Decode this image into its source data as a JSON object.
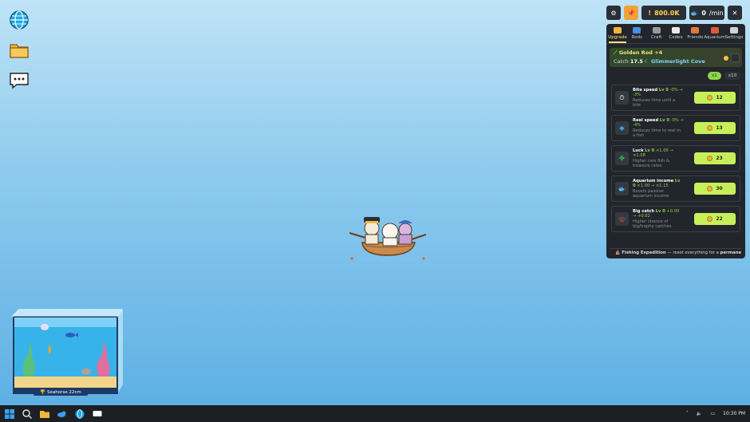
{
  "toolbar": {
    "settings_icon": "gear-icon",
    "pin_icon": "pin-icon",
    "money": "800.0K",
    "rate_value": "0",
    "rate_unit": "/min",
    "close_icon": "close-icon"
  },
  "tabs": [
    {
      "label": "Upgrade",
      "active": true
    },
    {
      "label": "Rods"
    },
    {
      "label": "Craft"
    },
    {
      "label": "Codex"
    },
    {
      "label": "Friends"
    },
    {
      "label": "Aquarium"
    },
    {
      "label": "Settings"
    }
  ],
  "rod": {
    "name": "Golden Rod +4",
    "catch_label": "Catch",
    "catch_value": "17.5",
    "location": "Glimmerlight Cove"
  },
  "multipliers": [
    "x1",
    "x10"
  ],
  "upgrades": [
    {
      "name": "Bite speed",
      "lv": "Lv 0",
      "delta": "-0% → -3%",
      "desc": "Reduces time until a bite",
      "cost": "12",
      "icon": "stopwatch-icon"
    },
    {
      "name": "Reel speed",
      "lv": "Lv 0",
      "delta": "-0% → -4%",
      "desc": "Reduces time to reel in a fish",
      "cost": "13",
      "icon": "reel-icon"
    },
    {
      "name": "Luck",
      "lv": "Lv 0",
      "delta": "×1.00 → ×1.08",
      "desc": "Higher rare fish & treasure rates",
      "cost": "23",
      "icon": "clover-icon"
    },
    {
      "name": "Aquarium income",
      "lv": "Lv 0",
      "delta": "×1.00 → ×1.15",
      "desc": "Boosts passive aquarium income",
      "cost": "30",
      "icon": "fish-icon"
    },
    {
      "name": "Big catch",
      "lv": "Lv 0",
      "delta": "+0.00 → +0.02",
      "desc": "Higher chance of big/trophy catches",
      "cost": "22",
      "icon": "target-icon"
    }
  ],
  "expedition": {
    "title": "Fishing Expedition",
    "text": "— reset everything for a",
    "highlight": "permanent"
  },
  "aquarium": {
    "label": "Seahorse 22cm"
  },
  "taskbar": {
    "time": "10:30 PM"
  },
  "colors": {
    "accent_green": "#c7ef5a",
    "panel_bg": "#22262c",
    "gold": "#ffcf4d",
    "sky_top": "#bfe3f6",
    "sky_bottom": "#5aaee3"
  }
}
